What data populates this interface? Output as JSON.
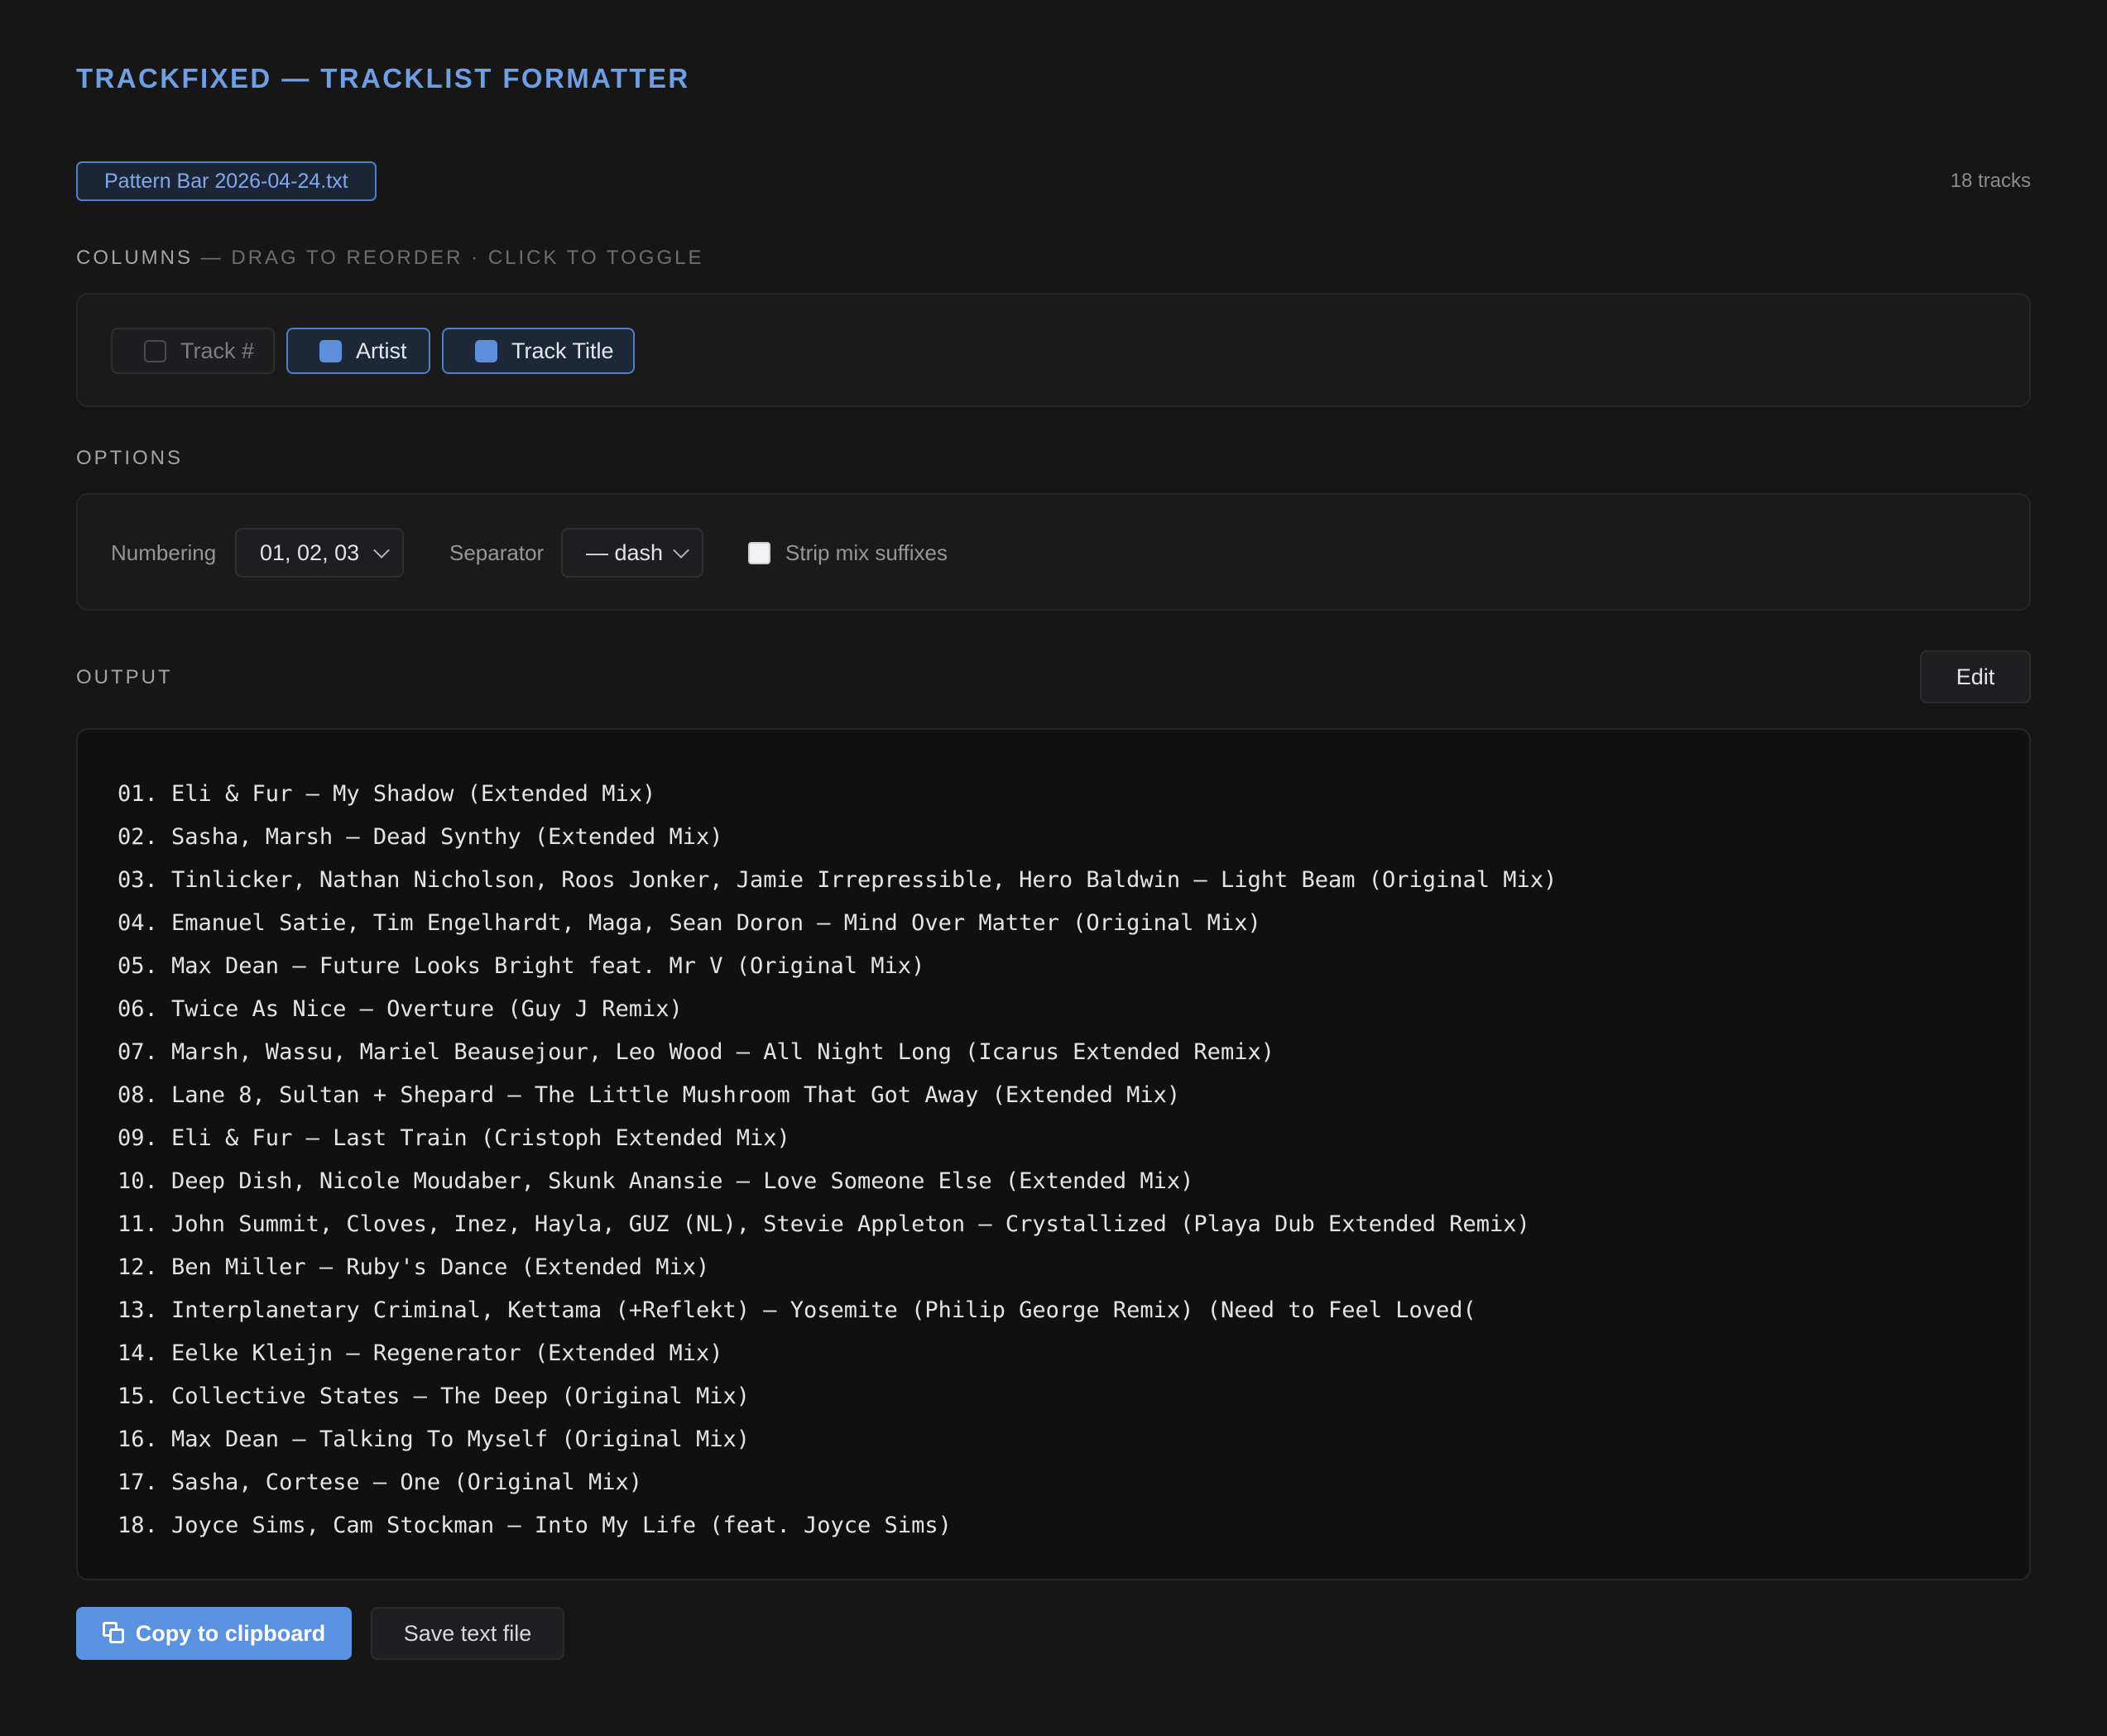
{
  "header": {
    "title": "TRACKFIXED — TRACKLIST FORMATTER",
    "file_name": "Pattern Bar 2026-04-24.txt",
    "track_count": "18 tracks"
  },
  "columns": {
    "label": "COLUMNS",
    "hint": "— DRAG TO REORDER · CLICK TO TOGGLE",
    "items": [
      {
        "label": "Track #",
        "checked": false
      },
      {
        "label": "Artist",
        "checked": true
      },
      {
        "label": "Track Title",
        "checked": true
      }
    ]
  },
  "options": {
    "label": "OPTIONS",
    "numbering_label": "Numbering",
    "numbering_value": "01, 02, 03",
    "separator_label": "Separator",
    "separator_value": "— dash",
    "strip_label": "Strip mix suffixes",
    "strip_checked": false
  },
  "output": {
    "label": "OUTPUT",
    "edit_label": "Edit",
    "lines": [
      "01. Eli & Fur – My Shadow (Extended Mix)",
      "02. Sasha, Marsh – Dead Synthy (Extended Mix)",
      "03. Tinlicker, Nathan Nicholson, Roos Jonker, Jamie Irrepressible, Hero Baldwin – Light Beam (Original Mix)",
      "04. Emanuel Satie, Tim Engelhardt, Maga, Sean Doron – Mind Over Matter (Original Mix)",
      "05. Max Dean – Future Looks Bright feat. Mr V (Original Mix)",
      "06. Twice As Nice – Overture (Guy J Remix)",
      "07. Marsh, Wassu, Mariel Beausejour, Leo Wood – All Night Long (Icarus Extended Remix)",
      "08. Lane 8, Sultan + Shepard – The Little Mushroom That Got Away (Extended Mix)",
      "09. Eli & Fur – Last Train (Cristoph Extended Mix)",
      "10. Deep Dish, Nicole Moudaber, Skunk Anansie – Love Someone Else (Extended Mix)",
      "11. John Summit, Cloves, Inez, Hayla, GUZ (NL), Stevie Appleton – Crystallized (Playa Dub Extended Remix)",
      "12. Ben Miller – Ruby's Dance (Extended Mix)",
      "13. Interplanetary Criminal, Kettama (+Reflekt) – Yosemite (Philip George Remix) (Need to Feel Loved(",
      "14. Eelke Kleijn – Regenerator (Extended Mix)",
      "15. Collective States – The Deep (Original Mix)",
      "16. Max Dean – Talking To Myself (Original Mix)",
      "17. Sasha, Cortese – One (Original Mix)",
      "18. Joyce Sims, Cam Stockman – Into My Life (feat. Joyce Sims)"
    ]
  },
  "actions": {
    "copy_label": "Copy to clipboard",
    "save_label": "Save text file",
    "accent_color": "#5b92df"
  },
  "icons": {
    "copy": "copy-icon",
    "chevron": "chevron-down-icon"
  }
}
